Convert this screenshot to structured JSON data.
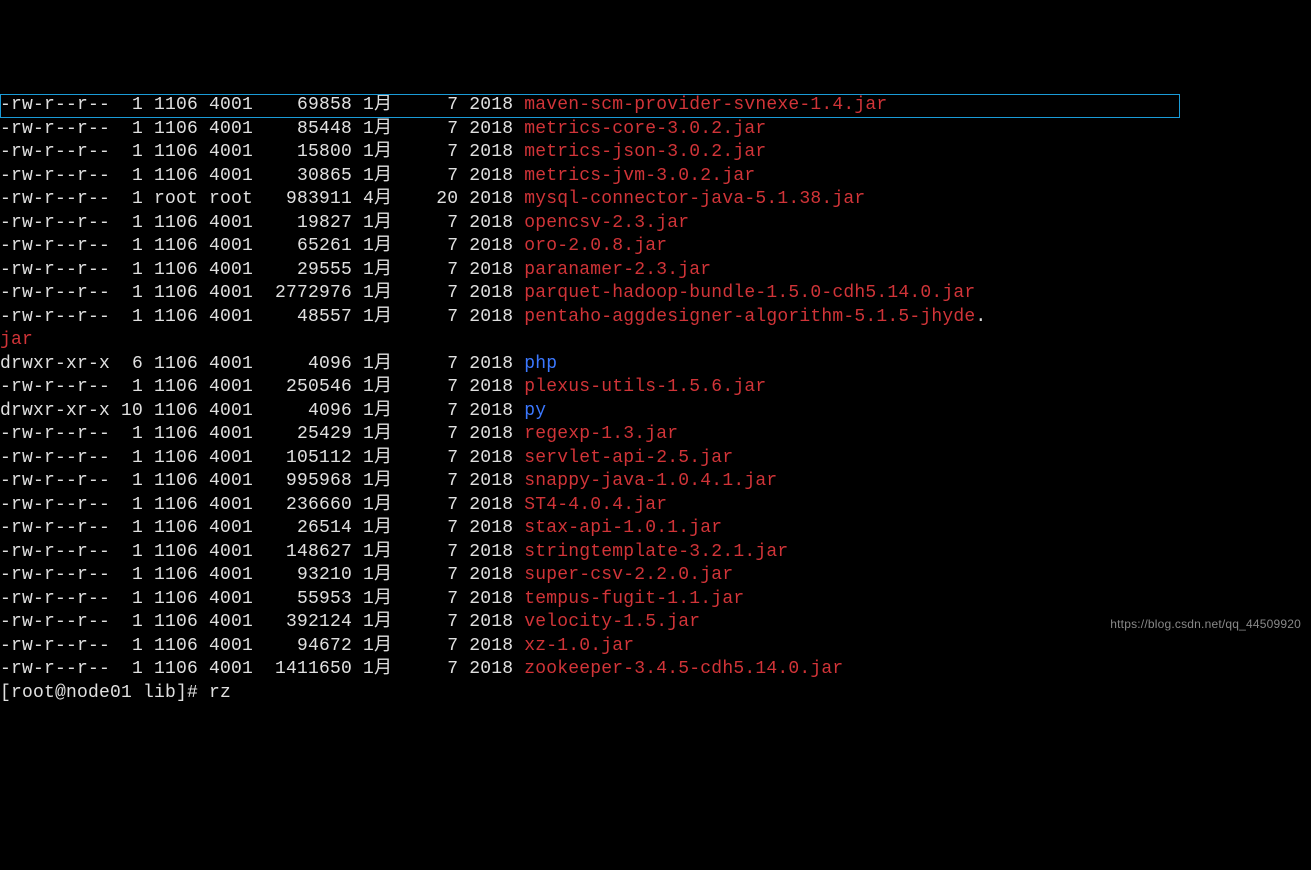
{
  "rows": [
    {
      "perms": "-rw-r--r--",
      "links": "1",
      "owner": "1106",
      "group": "4001",
      "size": "69858",
      "month": "1月",
      "day": "7",
      "year": "2018",
      "name": "maven-scm-provider-svnexe-1.4.jar",
      "type": "file"
    },
    {
      "perms": "-rw-r--r--",
      "links": "1",
      "owner": "1106",
      "group": "4001",
      "size": "85448",
      "month": "1月",
      "day": "7",
      "year": "2018",
      "name": "metrics-core-3.0.2.jar",
      "type": "file"
    },
    {
      "perms": "-rw-r--r--",
      "links": "1",
      "owner": "1106",
      "group": "4001",
      "size": "15800",
      "month": "1月",
      "day": "7",
      "year": "2018",
      "name": "metrics-json-3.0.2.jar",
      "type": "file"
    },
    {
      "perms": "-rw-r--r--",
      "links": "1",
      "owner": "1106",
      "group": "4001",
      "size": "30865",
      "month": "1月",
      "day": "7",
      "year": "2018",
      "name": "metrics-jvm-3.0.2.jar",
      "type": "file"
    },
    {
      "perms": "-rw-r--r--",
      "links": "1",
      "owner": "root",
      "group": "root",
      "size": "983911",
      "month": "4月",
      "day": "20",
      "year": "2018",
      "name": "mysql-connector-java-5.1.38.jar",
      "type": "file",
      "highlight": true
    },
    {
      "perms": "-rw-r--r--",
      "links": "1",
      "owner": "1106",
      "group": "4001",
      "size": "19827",
      "month": "1月",
      "day": "7",
      "year": "2018",
      "name": "opencsv-2.3.jar",
      "type": "file"
    },
    {
      "perms": "-rw-r--r--",
      "links": "1",
      "owner": "1106",
      "group": "4001",
      "size": "65261",
      "month": "1月",
      "day": "7",
      "year": "2018",
      "name": "oro-2.0.8.jar",
      "type": "file"
    },
    {
      "perms": "-rw-r--r--",
      "links": "1",
      "owner": "1106",
      "group": "4001",
      "size": "29555",
      "month": "1月",
      "day": "7",
      "year": "2018",
      "name": "paranamer-2.3.jar",
      "type": "file"
    },
    {
      "perms": "-rw-r--r--",
      "links": "1",
      "owner": "1106",
      "group": "4001",
      "size": "2772976",
      "month": "1月",
      "day": "7",
      "year": "2018",
      "name": "parquet-hadoop-bundle-1.5.0-cdh5.14.0.jar",
      "type": "file"
    },
    {
      "perms": "-rw-r--r--",
      "links": "1",
      "owner": "1106",
      "group": "4001",
      "size": "48557",
      "month": "1月",
      "day": "7",
      "year": "2018",
      "name": "pentaho-aggdesigner-algorithm-5.1.5-jhyde",
      "type": "file",
      "wrap": "jar"
    },
    {
      "perms": "drwxr-xr-x",
      "links": "6",
      "owner": "1106",
      "group": "4001",
      "size": "4096",
      "month": "1月",
      "day": "7",
      "year": "2018",
      "name": "php",
      "type": "dir"
    },
    {
      "perms": "-rw-r--r--",
      "links": "1",
      "owner": "1106",
      "group": "4001",
      "size": "250546",
      "month": "1月",
      "day": "7",
      "year": "2018",
      "name": "plexus-utils-1.5.6.jar",
      "type": "file"
    },
    {
      "perms": "drwxr-xr-x",
      "links": "10",
      "owner": "1106",
      "group": "4001",
      "size": "4096",
      "month": "1月",
      "day": "7",
      "year": "2018",
      "name": "py",
      "type": "dir"
    },
    {
      "perms": "-rw-r--r--",
      "links": "1",
      "owner": "1106",
      "group": "4001",
      "size": "25429",
      "month": "1月",
      "day": "7",
      "year": "2018",
      "name": "regexp-1.3.jar",
      "type": "file"
    },
    {
      "perms": "-rw-r--r--",
      "links": "1",
      "owner": "1106",
      "group": "4001",
      "size": "105112",
      "month": "1月",
      "day": "7",
      "year": "2018",
      "name": "servlet-api-2.5.jar",
      "type": "file"
    },
    {
      "perms": "-rw-r--r--",
      "links": "1",
      "owner": "1106",
      "group": "4001",
      "size": "995968",
      "month": "1月",
      "day": "7",
      "year": "2018",
      "name": "snappy-java-1.0.4.1.jar",
      "type": "file"
    },
    {
      "perms": "-rw-r--r--",
      "links": "1",
      "owner": "1106",
      "group": "4001",
      "size": "236660",
      "month": "1月",
      "day": "7",
      "year": "2018",
      "name": "ST4-4.0.4.jar",
      "type": "file"
    },
    {
      "perms": "-rw-r--r--",
      "links": "1",
      "owner": "1106",
      "group": "4001",
      "size": "26514",
      "month": "1月",
      "day": "7",
      "year": "2018",
      "name": "stax-api-1.0.1.jar",
      "type": "file"
    },
    {
      "perms": "-rw-r--r--",
      "links": "1",
      "owner": "1106",
      "group": "4001",
      "size": "148627",
      "month": "1月",
      "day": "7",
      "year": "2018",
      "name": "stringtemplate-3.2.1.jar",
      "type": "file"
    },
    {
      "perms": "-rw-r--r--",
      "links": "1",
      "owner": "1106",
      "group": "4001",
      "size": "93210",
      "month": "1月",
      "day": "7",
      "year": "2018",
      "name": "super-csv-2.2.0.jar",
      "type": "file"
    },
    {
      "perms": "-rw-r--r--",
      "links": "1",
      "owner": "1106",
      "group": "4001",
      "size": "55953",
      "month": "1月",
      "day": "7",
      "year": "2018",
      "name": "tempus-fugit-1.1.jar",
      "type": "file"
    },
    {
      "perms": "-rw-r--r--",
      "links": "1",
      "owner": "1106",
      "group": "4001",
      "size": "392124",
      "month": "1月",
      "day": "7",
      "year": "2018",
      "name": "velocity-1.5.jar",
      "type": "file"
    },
    {
      "perms": "-rw-r--r--",
      "links": "1",
      "owner": "1106",
      "group": "4001",
      "size": "94672",
      "month": "1月",
      "day": "7",
      "year": "2018",
      "name": "xz-1.0.jar",
      "type": "file"
    },
    {
      "perms": "-rw-r--r--",
      "links": "1",
      "owner": "1106",
      "group": "4001",
      "size": "1411650",
      "month": "1月",
      "day": "7",
      "year": "2018",
      "name": "zookeeper-3.4.5-cdh5.14.0.jar",
      "type": "file"
    }
  ],
  "prompt": {
    "text": "[root@node01 lib]# ",
    "command": "rz"
  },
  "wrap_text": ".jar",
  "watermark": "https://blog.csdn.net/qq_44509920"
}
